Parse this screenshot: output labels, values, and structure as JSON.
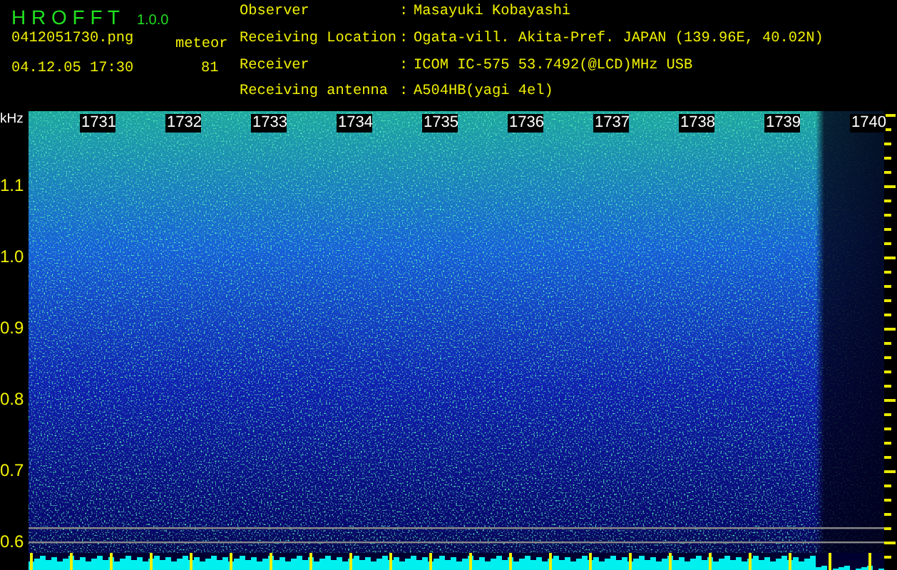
{
  "app": {
    "name": "H R O F F T",
    "version": "1.0.0"
  },
  "file": {
    "name": "0412051730.png",
    "datetime": "04.12.05 17:30"
  },
  "meteor": {
    "label": "meteor",
    "count": "81"
  },
  "info": [
    {
      "label": "Observer",
      "separator": ":",
      "value": "Masayuki Kobayashi"
    },
    {
      "label": "Receiving Location",
      "separator": ":",
      "value": "Ogata-vill. Akita-Pref. JAPAN (139.96E, 40.02N)"
    },
    {
      "label": "Receiver",
      "separator": ":",
      "value": "ICOM IC-575 53.7492(@LCD)MHz USB"
    },
    {
      "label": "Receiving antenna",
      "separator": ":",
      "value": "A504HB(yagi 4el)"
    }
  ],
  "axis": {
    "unit": "kHz",
    "time_labels": [
      "1731",
      "1732",
      "1733",
      "1734",
      "1735",
      "1736",
      "1737",
      "1738",
      "1739",
      "1740"
    ],
    "freq_labels": [
      "1.1",
      "1.0",
      "0.9",
      "0.8",
      "0.7",
      "0.6"
    ]
  }
}
